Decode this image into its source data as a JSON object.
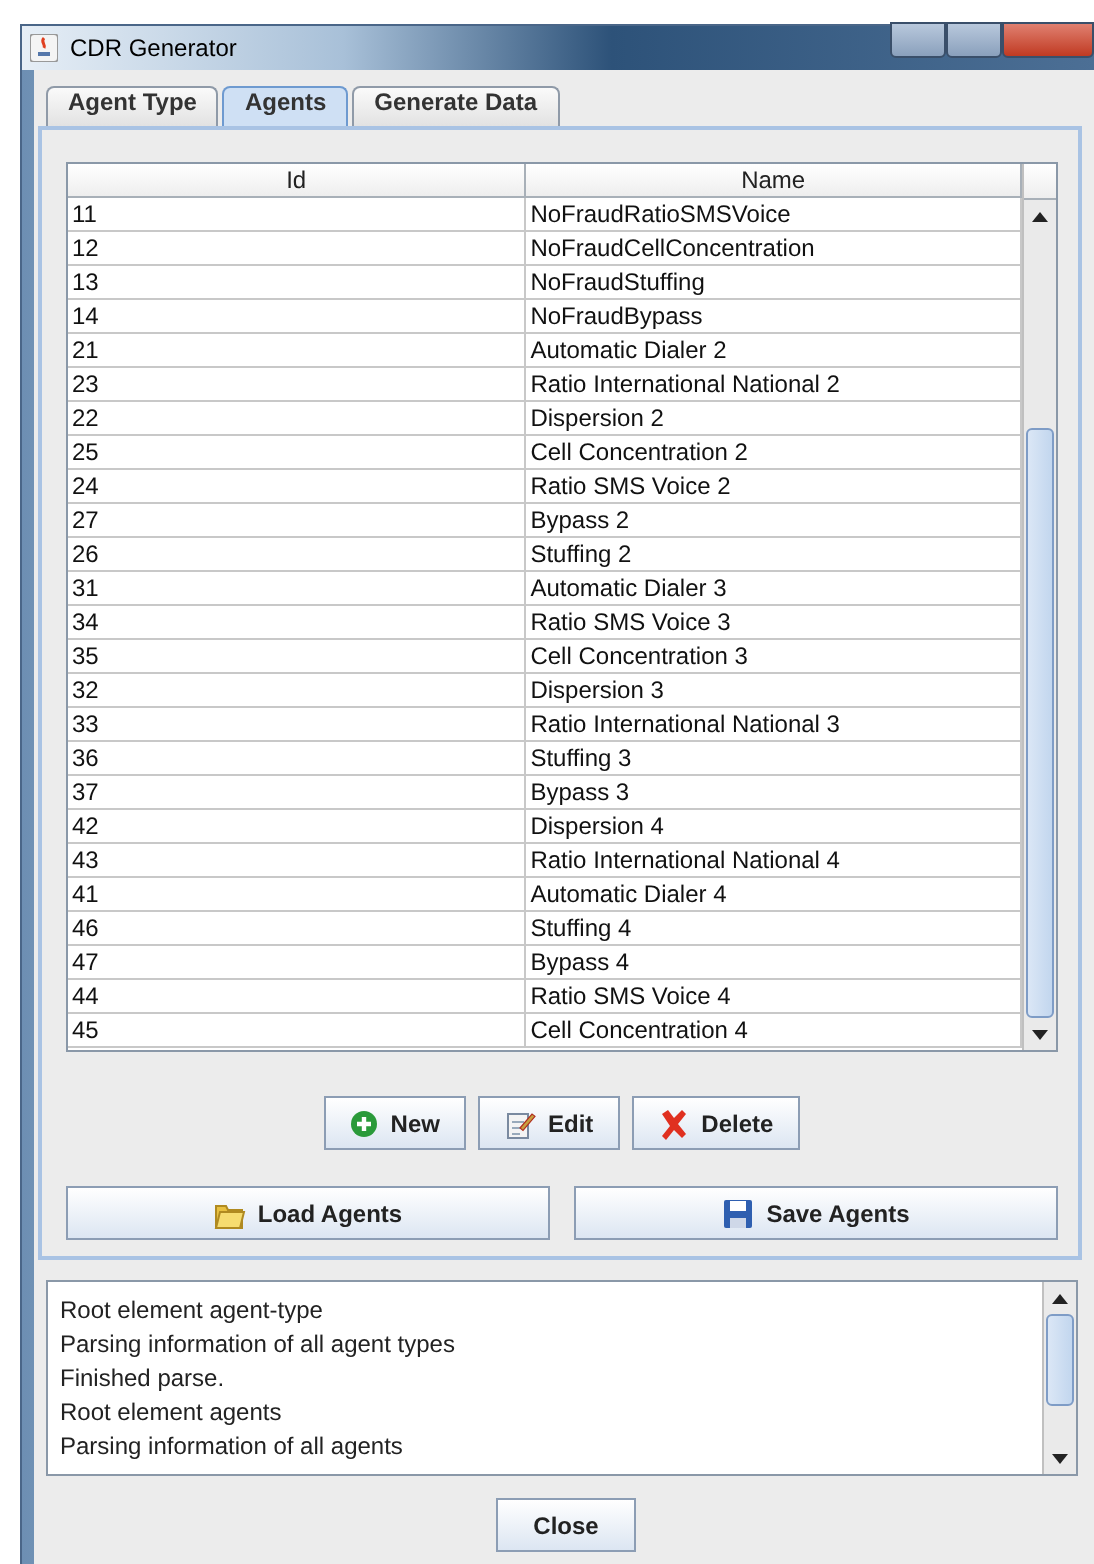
{
  "window": {
    "title": "CDR Generator"
  },
  "tabs": [
    {
      "label": "Agent Type",
      "selected": false
    },
    {
      "label": "Agents",
      "selected": true
    },
    {
      "label": "Generate Data",
      "selected": false
    }
  ],
  "table": {
    "columns": [
      "Id",
      "Name"
    ],
    "rows": [
      [
        "11",
        "NoFraudRatioSMSVoice"
      ],
      [
        "12",
        "NoFraudCellConcentration"
      ],
      [
        "13",
        "NoFraudStuffing"
      ],
      [
        "14",
        "NoFraudBypass"
      ],
      [
        "21",
        "Automatic Dialer 2"
      ],
      [
        "23",
        "Ratio International National 2"
      ],
      [
        "22",
        "Dispersion 2"
      ],
      [
        "25",
        "Cell Concentration 2"
      ],
      [
        "24",
        "Ratio SMS Voice 2"
      ],
      [
        "27",
        "Bypass 2"
      ],
      [
        "26",
        "Stuffing 2"
      ],
      [
        "31",
        "Automatic Dialer 3"
      ],
      [
        "34",
        "Ratio SMS Voice 3"
      ],
      [
        "35",
        "Cell Concentration 3"
      ],
      [
        "32",
        "Dispersion 3"
      ],
      [
        "33",
        "Ratio International National 3"
      ],
      [
        "36",
        "Stuffing 3"
      ],
      [
        "37",
        "Bypass 3"
      ],
      [
        "42",
        "Dispersion 4"
      ],
      [
        "43",
        "Ratio International National 4"
      ],
      [
        "41",
        "Automatic Dialer 4"
      ],
      [
        "46",
        "Stuffing 4"
      ],
      [
        "47",
        "Bypass 4"
      ],
      [
        "44",
        "Ratio SMS Voice 4"
      ],
      [
        "45",
        "Cell Concentration 4"
      ]
    ]
  },
  "actions": [
    {
      "label": "New",
      "kind": "new"
    },
    {
      "label": "Edit",
      "kind": "edit"
    },
    {
      "label": "Delete",
      "kind": "delete"
    }
  ],
  "file_actions": [
    {
      "label": "Load Agents",
      "kind": "load"
    },
    {
      "label": "Save Agents",
      "kind": "save"
    }
  ],
  "log": [
    "Root element agent-type",
    "Parsing information of all agent types",
    "Finished parse.",
    "Root element agents",
    "Parsing information of all agents"
  ],
  "close_button": "Close"
}
